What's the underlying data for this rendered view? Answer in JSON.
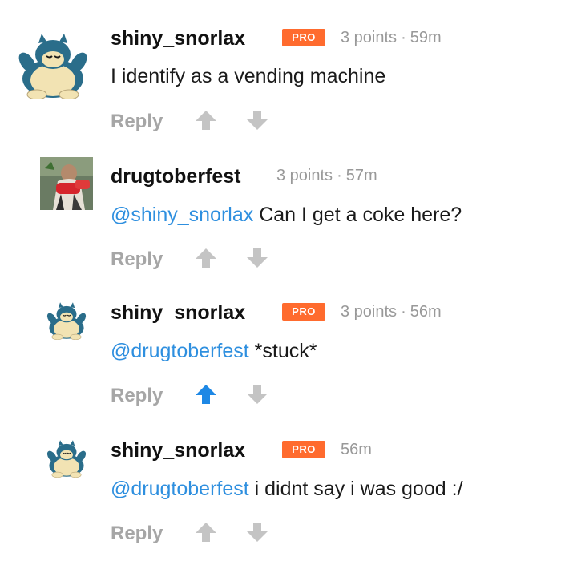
{
  "comments": [
    {
      "author": "shiny_snorlax",
      "badge": "PRO",
      "points": "3 points",
      "separator": "·",
      "time": "59m",
      "mention": "",
      "text": "I identify as a vending machine",
      "reply_label": "Reply",
      "upvoted": false
    },
    {
      "author": "drugtoberfest",
      "badge": "",
      "points": "3 points",
      "separator": "·",
      "time": "57m",
      "mention": "@shiny_snorlax",
      "text": " Can I get a coke here?",
      "reply_label": "Reply",
      "upvoted": false
    },
    {
      "author": "shiny_snorlax",
      "badge": "PRO",
      "points": "3 points",
      "separator": "·",
      "time": "56m",
      "mention": "@drugtoberfest",
      "text": " *stuck*",
      "reply_label": "Reply",
      "upvoted": true
    },
    {
      "author": "shiny_snorlax",
      "badge": "PRO",
      "points": "",
      "separator": "",
      "time": "56m",
      "mention": "@drugtoberfest",
      "text": " i didnt say i was good :/",
      "reply_label": "Reply",
      "upvoted": false
    }
  ],
  "colors": {
    "badge": "#ff6b2e",
    "mention": "#2e8fdf",
    "upvote_active": "#1e88e5",
    "vote_inactive": "#c4c4c4",
    "meta": "#999999"
  },
  "icons": {
    "snorlax_avatar": "snorlax-avatar",
    "drugtoberfest_avatar": "user-avatar",
    "upvote": "upvote-arrow-icon",
    "downvote": "downvote-arrow-icon"
  }
}
